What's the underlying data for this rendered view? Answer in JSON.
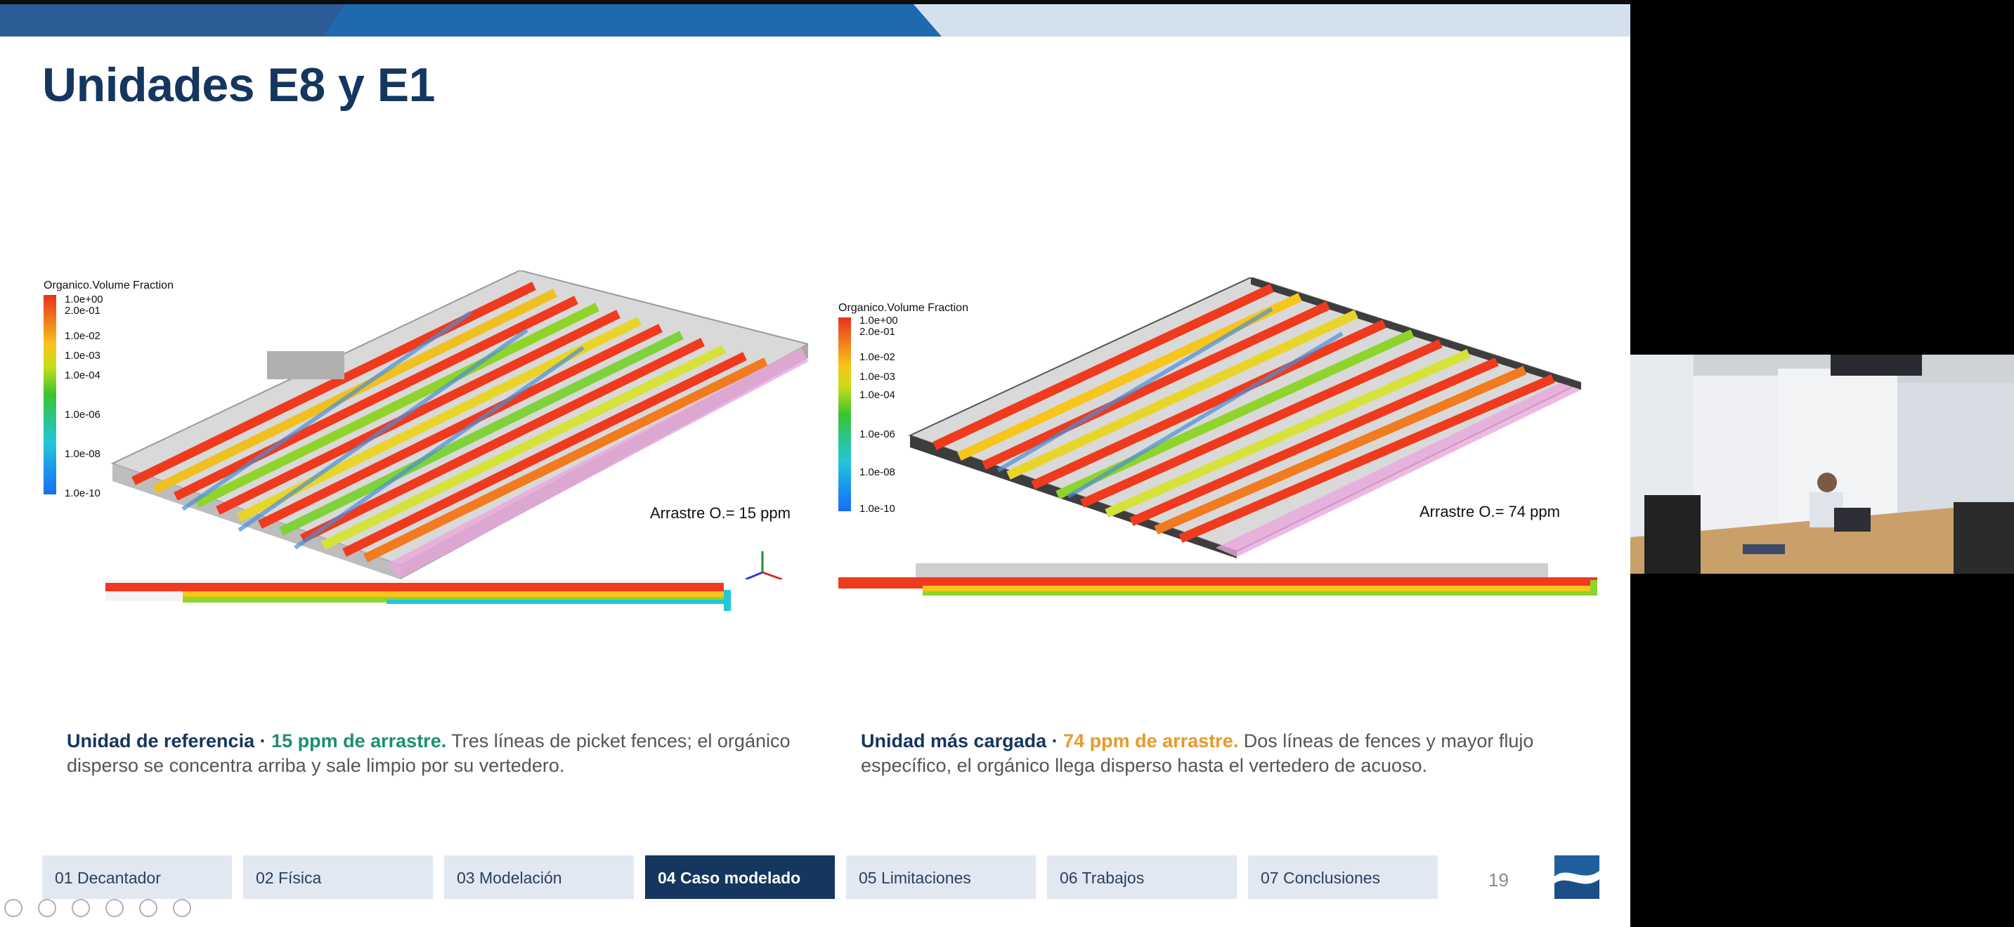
{
  "slide": {
    "title": "Unidades E8 y E1",
    "page_number": "19"
  },
  "figures": [
    {
      "legend_title": "Organico.Volume Fraction",
      "ticks": [
        "1.0e+00",
        "2.0e-01",
        "1.0e-02",
        "1.0e-03",
        "1.0e-04",
        "1.0e-06",
        "1.0e-08",
        "1.0e-10"
      ],
      "annotation": "Arrastre O.= 15 ppm"
    },
    {
      "legend_title": "Organico.Volume Fraction",
      "ticks": [
        "1.0e+00",
        "2.0e-01",
        "1.0e-02",
        "1.0e-03",
        "1.0e-04",
        "1.0e-06",
        "1.0e-08",
        "1.0e-10"
      ],
      "annotation": "Arrastre O.= 74 ppm"
    }
  ],
  "captions": {
    "left": {
      "lead": "Unidad de referencia",
      "sep": " · ",
      "highlight": "15 ppm de arrastre.",
      "body": " Tres líneas de picket fences; el orgánico disperso se concentra arriba y sale limpio por su vertedero."
    },
    "right": {
      "lead": "Unidad más cargada",
      "sep": " · ",
      "highlight": "74 ppm de arrastre.",
      "body": " Dos líneas de fences y mayor flujo específico, el orgánico llega disperso hasta el vertedero de acuoso."
    }
  },
  "nav": {
    "items": [
      {
        "label": "01 Decantador",
        "active": false
      },
      {
        "label": "02 Física",
        "active": false
      },
      {
        "label": "03 Modelación",
        "active": false
      },
      {
        "label": "04 Caso modelado",
        "active": true
      },
      {
        "label": "05 Limitaciones",
        "active": false
      },
      {
        "label": "06 Trabajos",
        "active": false
      },
      {
        "label": "07 Conclusiones",
        "active": false
      }
    ]
  },
  "colors": {
    "title": "#14365f",
    "accent_green": "#1b8f72",
    "accent_orange": "#e59a2c",
    "nav_bg": "#e1e8f2",
    "nav_active": "#14365f"
  },
  "icons": [
    "axes-triad-icon",
    "webcam-participant-video",
    "presentation-logo-icon"
  ]
}
